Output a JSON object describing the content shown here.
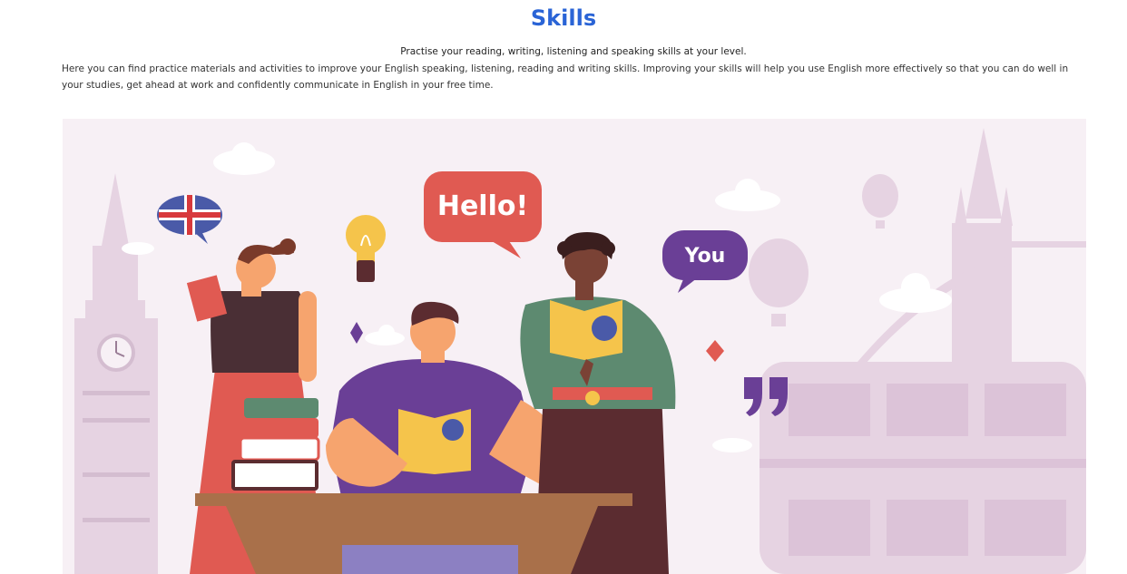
{
  "page": {
    "title": "Skills",
    "subtitle": "Practise your reading, writing, listening and speaking skills at your level.",
    "intro": "Here you can find practice materials and activities to improve your English speaking, listening, reading and writing skills. Improving your skills will help you use English more effectively so that you can do well in your studies, get ahead at work and confidently communicate in English in your free time."
  },
  "hero": {
    "bubble_hello": "Hello!",
    "bubble_you": "You",
    "colors": {
      "background": "#f7f0f5",
      "landmark": "#e6d3e2",
      "hello_bubble": "#e05a52",
      "you_bubble": "#6a3f96",
      "accent_blue": "#2a64d6"
    }
  }
}
